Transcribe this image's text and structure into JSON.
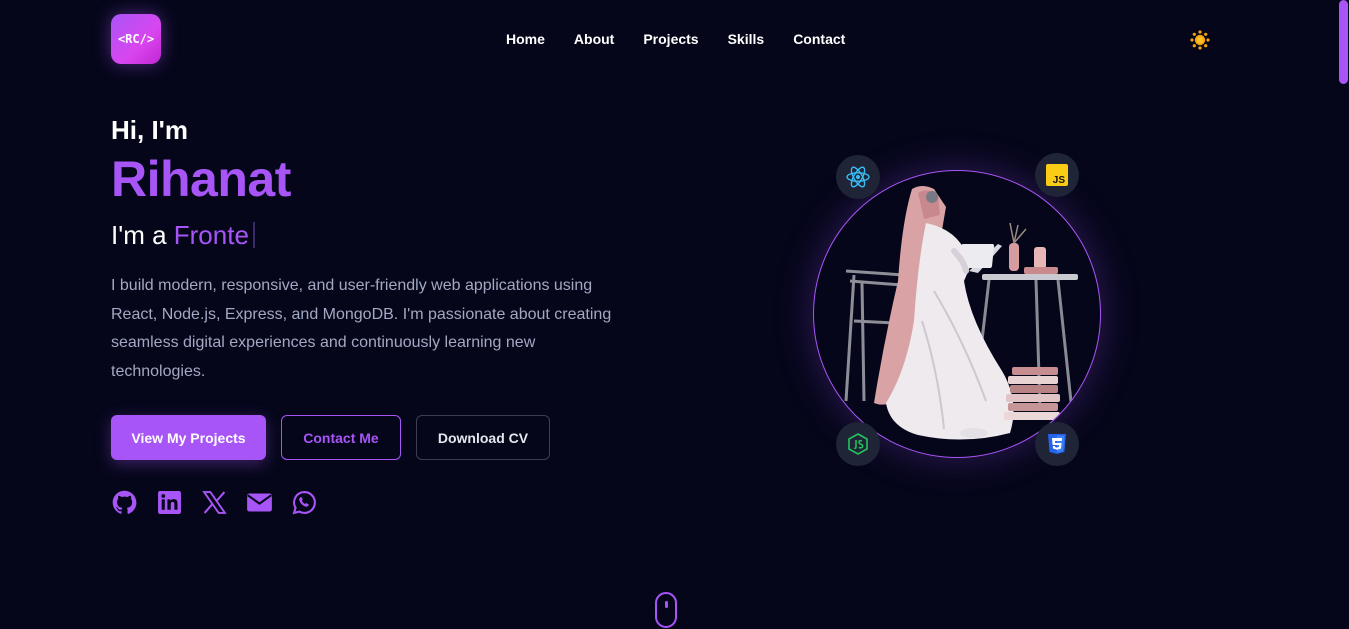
{
  "header": {
    "logo_text": "<RC/>",
    "nav": [
      "Home",
      "About",
      "Projects",
      "Skills",
      "Contact"
    ],
    "theme_icon": "sun-icon"
  },
  "hero": {
    "greeting": "Hi, I'm",
    "name": "Rihanat",
    "role_prefix": "I'm a",
    "role_typed": "Fronte",
    "bio": "I build modern, responsive, and user-friendly web applications using React, Node.js, Express, and MongoDB. I'm passionate about creating seamless digital experiences and continuously learning new technologies.",
    "buttons": {
      "primary": "View My Projects",
      "contact": "Contact Me",
      "cv": "Download CV"
    },
    "socials": [
      "github-icon",
      "linkedin-icon",
      "x-icon",
      "mail-icon",
      "whatsapp-icon"
    ],
    "tech_badges": [
      "react-icon",
      "javascript-icon",
      "nodejs-icon",
      "css3-icon"
    ],
    "badge_js_text": "JS"
  },
  "colors": {
    "background": "#05061a",
    "accent": "#a855f7",
    "muted_text": "#a3a8c3",
    "badge_bg": "#1f2436"
  }
}
